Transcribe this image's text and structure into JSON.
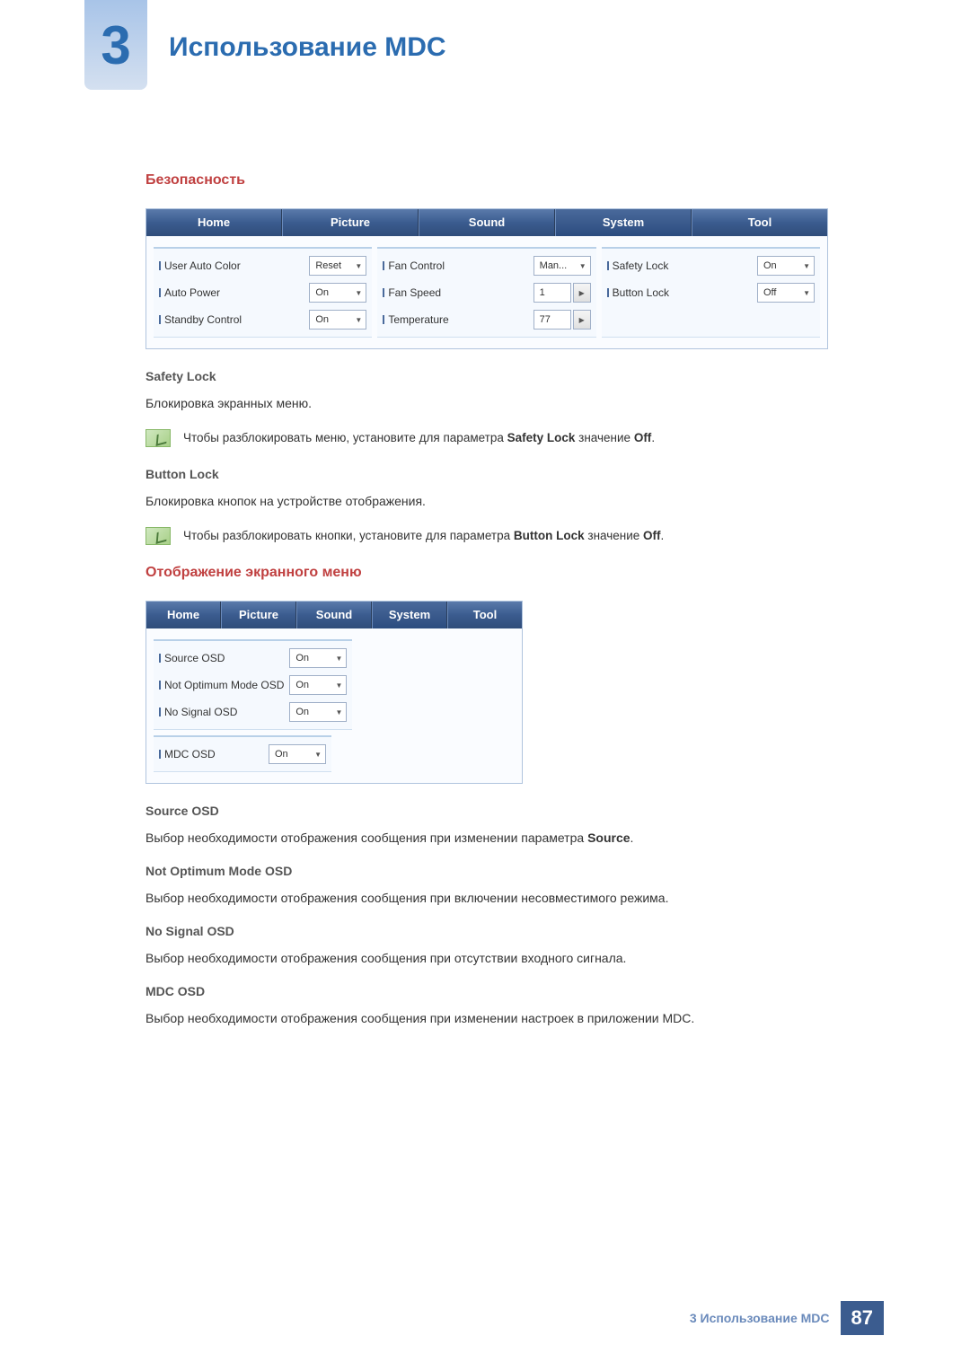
{
  "chapter": {
    "number": "3",
    "title": "Использование MDC"
  },
  "section_security": "Безопасность",
  "tabs": [
    "Home",
    "Picture",
    "Sound",
    "System",
    "Tool"
  ],
  "panel1": {
    "col1": [
      {
        "label": "User Auto Color",
        "value": "Reset",
        "type": "dd2"
      },
      {
        "label": "Auto Power",
        "value": "On",
        "type": "dd"
      },
      {
        "label": "Standby Control",
        "value": "On",
        "type": "dd"
      }
    ],
    "col2": [
      {
        "label": "Fan Control",
        "value": "Man...",
        "type": "dd2"
      },
      {
        "label": "Fan Speed",
        "value": "1",
        "type": "spin"
      },
      {
        "label": "Temperature",
        "value": "77",
        "type": "spin"
      }
    ],
    "col3": [
      {
        "label": "Safety Lock",
        "value": "On",
        "type": "dd"
      },
      {
        "label": "Button Lock",
        "value": "Off",
        "type": "dd"
      }
    ]
  },
  "safety_lock": {
    "heading": "Safety Lock",
    "body": "Блокировка экранных меню.",
    "note_pre": "Чтобы разблокировать меню, установите для параметра ",
    "note_b1": "Safety Lock",
    "note_mid": " значение ",
    "note_b2": "Off",
    "note_end": "."
  },
  "button_lock": {
    "heading": "Button Lock",
    "body": "Блокировка кнопок на устройстве отображения.",
    "note_pre": "Чтобы разблокировать кнопки, установите для параметра ",
    "note_b1": "Button Lock",
    "note_mid": " значение ",
    "note_b2": "Off",
    "note_end": "."
  },
  "section_osd": "Отображение экранного меню",
  "panel2": {
    "left": [
      {
        "label": "Source OSD",
        "value": "On"
      },
      {
        "label": "Not Optimum Mode OSD",
        "value": "On"
      },
      {
        "label": "No Signal OSD",
        "value": "On"
      }
    ],
    "right": [
      {
        "label": "MDC OSD",
        "value": "On"
      }
    ]
  },
  "osd_source": {
    "heading": "Source OSD",
    "body_pre": "Выбор необходимости отображения сообщения при изменении параметра ",
    "body_b": "Source",
    "body_end": "."
  },
  "osd_notopt": {
    "heading": "Not Optimum Mode OSD",
    "body": "Выбор необходимости отображения сообщения при включении несовместимого режима."
  },
  "osd_nosignal": {
    "heading": "No Signal OSD",
    "body": "Выбор необходимости отображения сообщения при отсутствии входного сигнала."
  },
  "osd_mdc": {
    "heading": "MDC OSD",
    "body": "Выбор необходимости отображения сообщения при изменении настроек в приложении MDC."
  },
  "footer": {
    "text": "3 Использование MDC",
    "page": "87"
  }
}
